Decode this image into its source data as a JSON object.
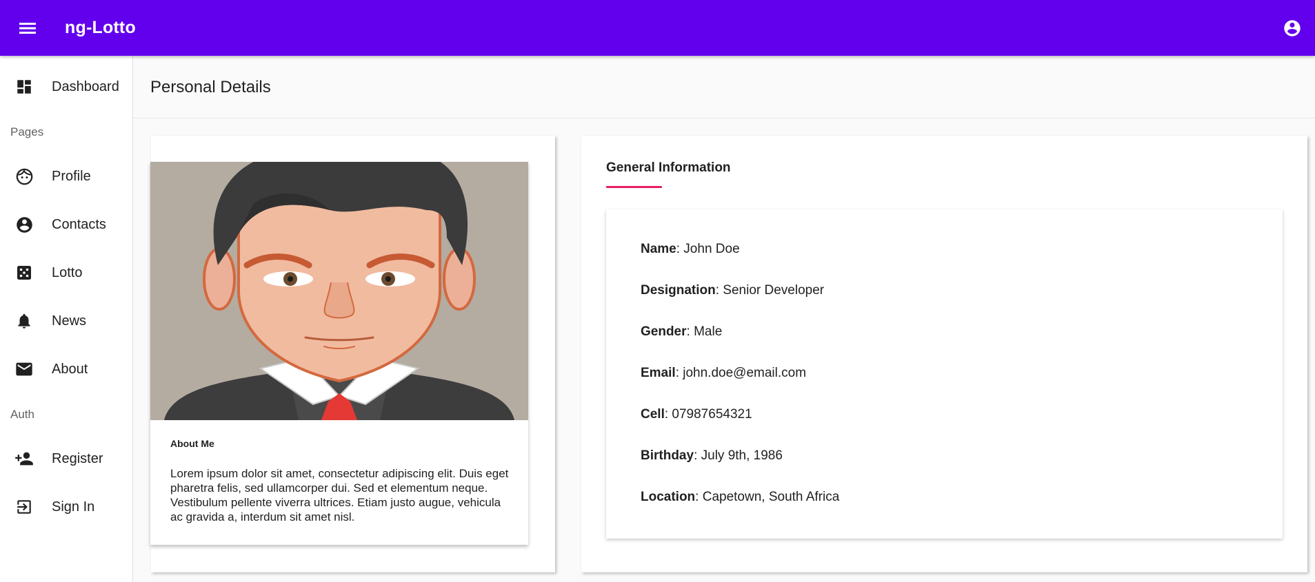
{
  "app": {
    "title": "ng-Lotto"
  },
  "sidebar": {
    "items": [
      {
        "label": "Dashboard",
        "icon": "dashboard-icon"
      },
      {
        "label": "Profile",
        "icon": "face-icon"
      },
      {
        "label": "Contacts",
        "icon": "account-circle-icon"
      },
      {
        "label": "Lotto",
        "icon": "dice-icon"
      },
      {
        "label": "News",
        "icon": "bell-icon"
      },
      {
        "label": "About",
        "icon": "mail-icon"
      },
      {
        "label": "Register",
        "icon": "person-add-icon"
      },
      {
        "label": "Sign In",
        "icon": "sign-in-icon"
      }
    ],
    "sections": {
      "pages": "Pages",
      "auth": "Auth"
    }
  },
  "page": {
    "title": "Personal Details"
  },
  "profile": {
    "about_title": "About Me",
    "about_text": "Lorem ipsum dolor sit amet, consectetur adipiscing elit. Duis eget pharetra felis, sed ullamcorper dui. Sed et elementum neque. Vestibulum pellente viverra ultrices. Etiam justo augue, vehicula ac gravida a, interdum sit amet nisl."
  },
  "general": {
    "tab_label": "General Information",
    "fields": [
      {
        "label": "Name",
        "value": ": John Doe"
      },
      {
        "label": "Designation",
        "value": ": Senior Developer"
      },
      {
        "label": "Gender",
        "value": ": Male"
      },
      {
        "label": "Email",
        "value": ": john.doe@email.com"
      },
      {
        "label": "Cell",
        "value": ": 07987654321"
      },
      {
        "label": "Birthday",
        "value": ": July 9th, 1986"
      },
      {
        "label": "Location",
        "value": ": Capetown, South Africa"
      }
    ]
  },
  "colors": {
    "primary": "#6200ee",
    "accent": "#e91e63"
  }
}
